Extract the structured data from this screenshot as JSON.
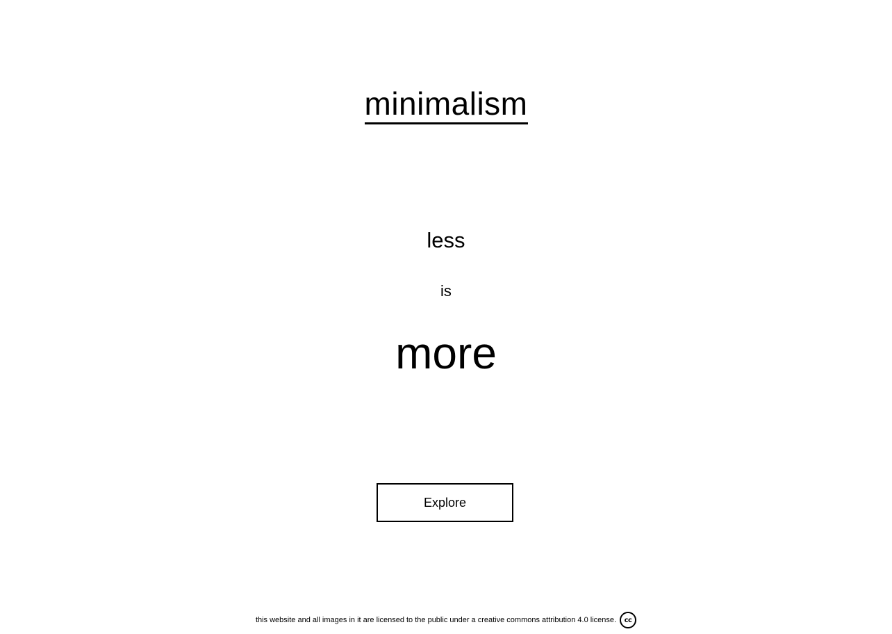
{
  "header": {
    "title": "minimalism"
  },
  "hero": {
    "line1": "less",
    "line2": "is",
    "line3": "more"
  },
  "actions": {
    "explore_label": "Explore"
  },
  "footer": {
    "license_text": "this website and all images in it are licensed to the public under a creative commons attribution 4.0 license.",
    "license_icon": "cc-icon",
    "license_icon_text": "cc"
  }
}
